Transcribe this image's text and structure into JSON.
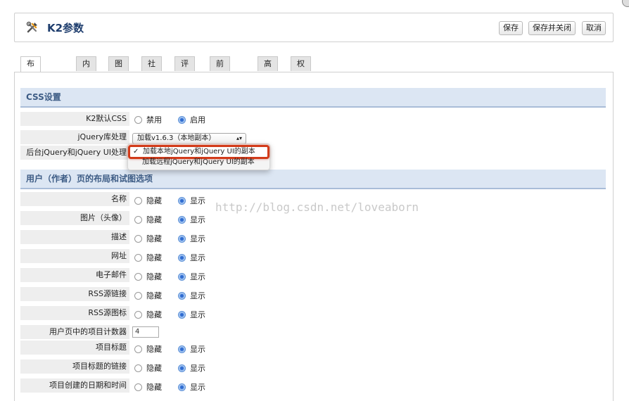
{
  "header": {
    "title": "K2参数",
    "icon": "tools-icon",
    "buttons": {
      "save": "保存",
      "save_close": "保存并关闭",
      "cancel": "取消"
    }
  },
  "tabs": [
    "布局和视图",
    "内容",
    "图片",
    "社交",
    "评论",
    "前台编辑",
    "高级",
    "权限"
  ],
  "css_section": {
    "title": "CSS设置",
    "k2_css_label": "K2默认CSS",
    "k2_css_options": [
      "禁用",
      "启用"
    ],
    "k2_css_selected": "启用",
    "jquery_label": "jQuery库处理",
    "jquery_value": "加载v1.6.3（本地副本）",
    "jquery_admin_label": "后台jQuery和jQuery UI处理",
    "dropdown_options": [
      "加载本地jQuery和jQuery UI的副本",
      "加载远程jQuery和jQuery UI的副本"
    ],
    "dropdown_selected_index": 0
  },
  "user_section": {
    "title": "用户（作者）页的布局和试图选项",
    "hide_label": "隐藏",
    "show_label": "显示",
    "rows": [
      {
        "label": "名称",
        "type": "radio",
        "selected": "显示"
      },
      {
        "label": "图片（头像）",
        "type": "radio",
        "selected": "显示"
      },
      {
        "label": "描述",
        "type": "radio",
        "selected": "显示"
      },
      {
        "label": "网址",
        "type": "radio",
        "selected": "显示"
      },
      {
        "label": "电子邮件",
        "type": "radio",
        "selected": "显示"
      },
      {
        "label": "RSS源链接",
        "type": "radio",
        "selected": "显示"
      },
      {
        "label": "RSS源图标",
        "type": "radio",
        "selected": "显示"
      },
      {
        "label": "用户页中的项目计数器",
        "type": "input",
        "value": "4"
      },
      {
        "label": "项目标题",
        "type": "radio",
        "selected": "显示"
      },
      {
        "label": "项目标题的链接",
        "type": "radio",
        "selected": "显示"
      },
      {
        "label": "项目创建的日期和时间",
        "type": "radio",
        "selected": "显示"
      }
    ]
  },
  "watermark": "http://blog.csdn.net/loveaborn",
  "colors": {
    "section_bg": "#dce6f3",
    "section_text": "#3d5c85",
    "title_text": "#1f3e6e",
    "highlight": "#d23b1a"
  }
}
